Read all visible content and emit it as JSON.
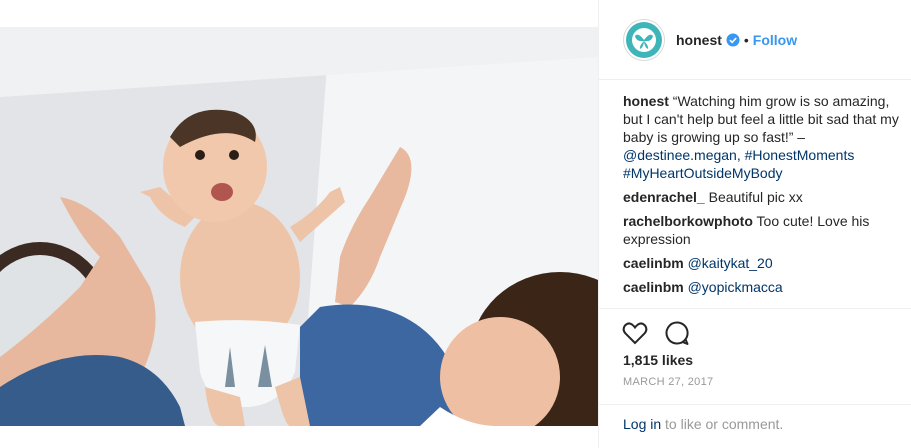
{
  "post": {
    "username": "honest",
    "dot": "•",
    "follow_label": "Follow",
    "caption_user": "honest",
    "caption_text": "“Watching him grow is so amazing, but I can't help but feel a little bit sad that my baby is growing up so fast!” –",
    "caption_mention": "@destinee.megan,",
    "caption_tag1": "#HonestMoments",
    "caption_tag2": "#MyHeartOutsideMyBody",
    "likes": "1,815 likes",
    "date": "MARCH 27, 2017",
    "login_link": "Log in",
    "login_text": " to like or comment."
  },
  "comments": [
    {
      "user": "edenrachel_",
      "text": "Beautiful pic xx"
    },
    {
      "user": "rachelborkowphoto",
      "text": "Too cute! Love his expression"
    },
    {
      "user": "caelinbm",
      "mention": "@kaitykat_20"
    },
    {
      "user": "caelinbm",
      "mention": "@yopickmacca"
    }
  ],
  "colors": {
    "brand_teal": "#3eb5b8",
    "link_blue": "#3897f0",
    "dark_link": "#003569"
  },
  "icons": [
    "heart-icon",
    "comment-icon",
    "verified-badge-icon"
  ]
}
